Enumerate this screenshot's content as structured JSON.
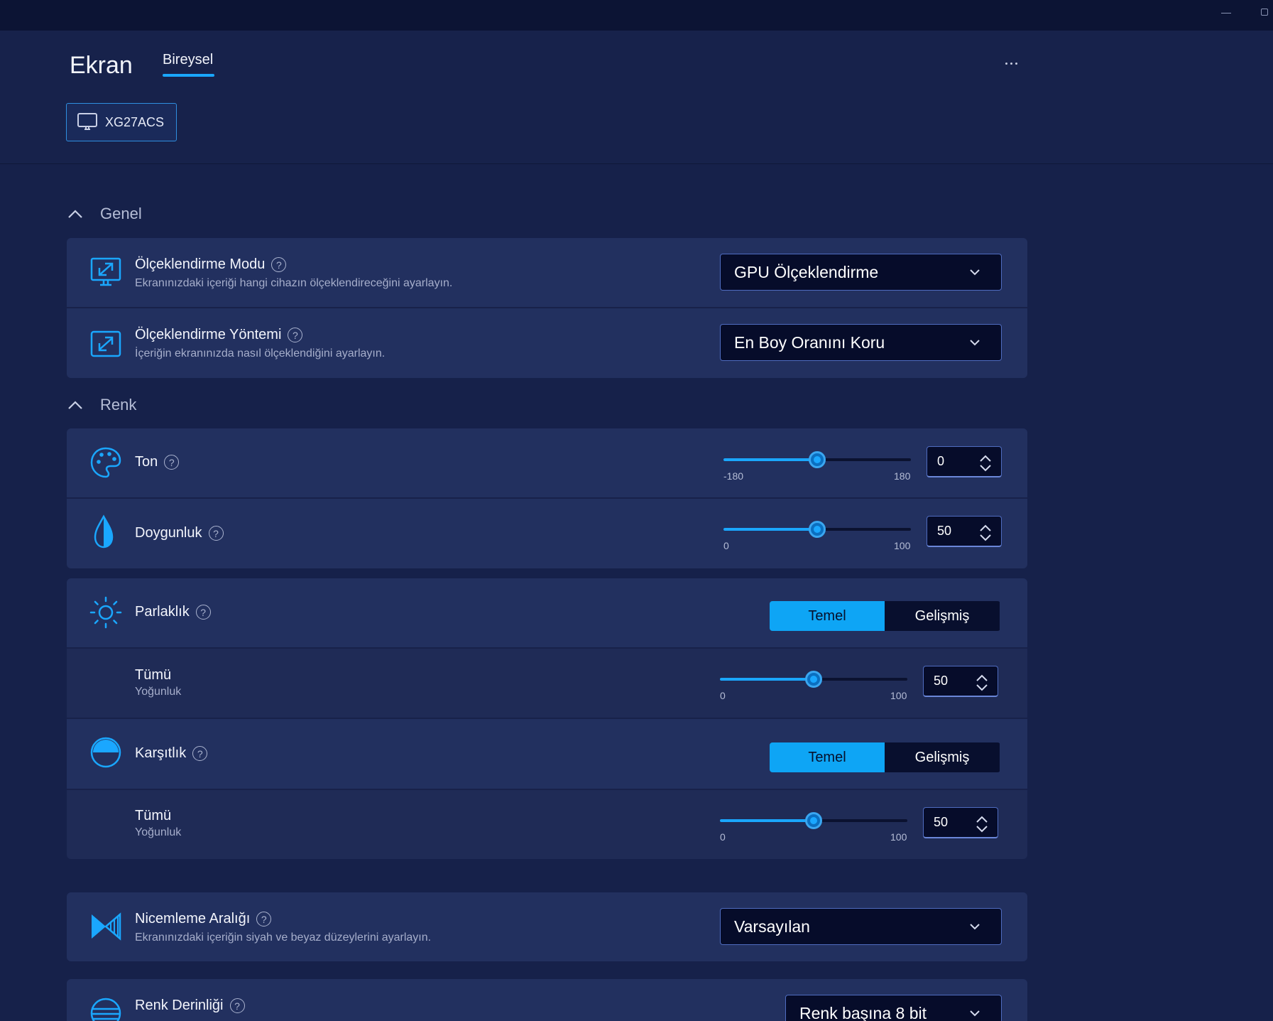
{
  "window": {
    "minimize_label": "",
    "maximize_label": ""
  },
  "header": {
    "title": "Ekran",
    "tabs": [
      {
        "label": "Bireysel",
        "active": true
      }
    ],
    "more_label": "...",
    "monitor": {
      "label": "XG27ACS",
      "icon": "monitor-icon"
    }
  },
  "accent_color": "#1aa7ff",
  "sections": {
    "genel": {
      "label": "Genel",
      "expanded": true
    },
    "renk": {
      "label": "Renk",
      "expanded": true
    }
  },
  "scaling_mode": {
    "title": "Ölçeklendirme Modu",
    "description": "Ekranınızdaki içeriği hangi cihazın ölçeklendireceğini ayarlayın.",
    "value": "GPU Ölçeklendirme",
    "help": "?"
  },
  "scaling_method": {
    "title": "Ölçeklendirme Yöntemi",
    "description": "İçeriğin ekranınızda nasıl ölçeklendiğini ayarlayın.",
    "value": "En Boy Oranını Koru",
    "help": "?"
  },
  "hue": {
    "title": "Ton",
    "help": "?",
    "min": "-180",
    "max": "180",
    "value": "0",
    "min_num": -180,
    "max_num": 180,
    "num": 0
  },
  "saturation": {
    "title": "Doygunluk",
    "help": "?",
    "min": "0",
    "max": "100",
    "value": "50",
    "min_num": 0,
    "max_num": 100,
    "num": 50
  },
  "brightness": {
    "title": "Parlaklık",
    "help": "?",
    "mode_basic": "Temel",
    "mode_advanced": "Gelişmiş",
    "selected": "Temel",
    "channel": "Tümü",
    "channel_sub": "Yoğunluk",
    "min": "0",
    "max": "100",
    "value": "50",
    "min_num": 0,
    "max_num": 100,
    "num": 50
  },
  "contrast": {
    "title": "Karşıtlık",
    "help": "?",
    "mode_basic": "Temel",
    "mode_advanced": "Gelişmiş",
    "selected": "Temel",
    "channel": "Tümü",
    "channel_sub": "Yoğunluk",
    "min": "0",
    "max": "100",
    "value": "50",
    "min_num": 0,
    "max_num": 100,
    "num": 50
  },
  "quantization": {
    "title": "Nicemleme Aralığı",
    "description": "Ekranınızdaki içeriğin siyah ve beyaz düzeylerini ayarlayın.",
    "value": "Varsayılan",
    "help": "?"
  },
  "color_depth": {
    "title": "Renk Derinliği",
    "value": "Renk başına 8 bit",
    "help": "?"
  }
}
